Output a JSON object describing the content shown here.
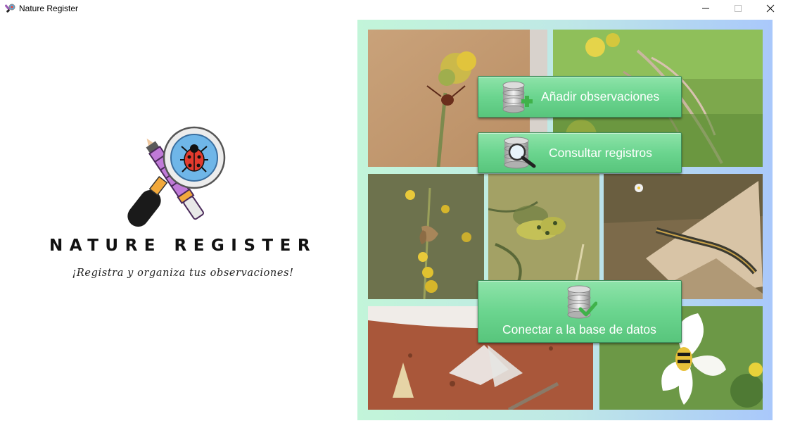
{
  "window": {
    "title": "Nature Register",
    "controls": [
      "minimize",
      "maximize",
      "close"
    ]
  },
  "branding": {
    "app_name": "NATURE REGISTER",
    "tagline": "¡Registra y organiza tus observaciones!",
    "logo_icon": "pencil-magnifier-ladybug-icon"
  },
  "menu": {
    "add_label": "Añadir observaciones",
    "query_label": "Consultar registros",
    "connect_label": "Conectar a la base de datos"
  },
  "photos": [
    {
      "id": "spider-flower",
      "icon": "spider-photo"
    },
    {
      "id": "grass-seed",
      "icon": "grass-photo"
    },
    {
      "id": "butterfly",
      "icon": "butterfly-photo"
    },
    {
      "id": "frog",
      "icon": "frog-photo"
    },
    {
      "id": "lizard",
      "icon": "lizard-photo"
    },
    {
      "id": "moths",
      "icon": "moth-photo"
    },
    {
      "id": "beetle-flower",
      "icon": "beetle-photo"
    }
  ],
  "colors": {
    "button_green": "#6bd58f",
    "panel_left": "#c2f5d9",
    "panel_right": "#a9c8fb"
  }
}
